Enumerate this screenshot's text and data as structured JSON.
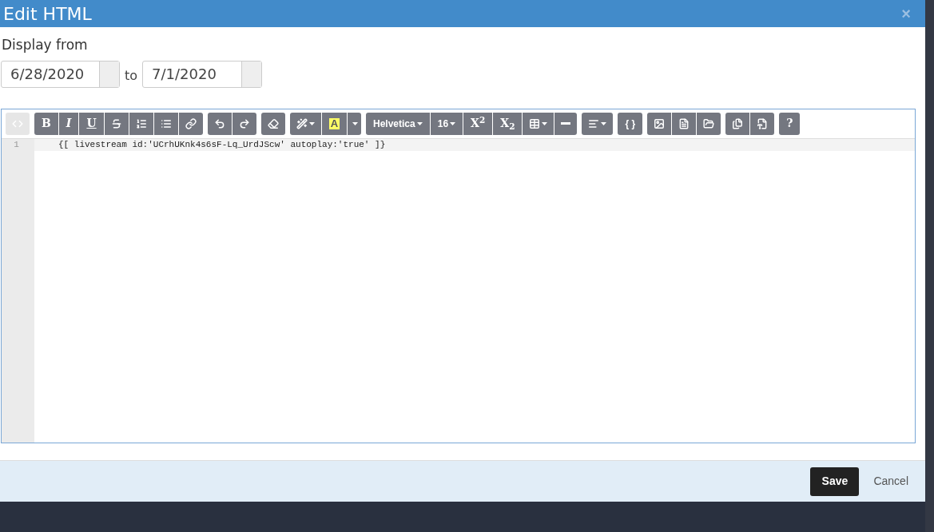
{
  "dialog": {
    "title": "Edit HTML",
    "close": "×"
  },
  "display": {
    "label": "Display from",
    "from": "6/28/2020",
    "joiner": "to",
    "to": "7/1/2020"
  },
  "toolbar": [
    [
      {
        "kind": "icon",
        "disabled": true
      }
    ],
    [
      {
        "kind": "bold",
        "label": "B"
      },
      {
        "kind": "italic",
        "label": "I"
      },
      {
        "kind": "underline",
        "label": "U"
      },
      {
        "kind": "icon"
      },
      {
        "kind": "icon"
      },
      {
        "kind": "icon"
      },
      {
        "kind": "icon"
      }
    ],
    [
      {
        "kind": "icon"
      },
      {
        "kind": "icon"
      }
    ],
    [
      {
        "kind": "icon"
      }
    ],
    [
      {
        "kind": "icon",
        "caret": true
      },
      {
        "kind": "highlight",
        "label": "A"
      },
      {
        "kind": "caret"
      }
    ],
    [
      {
        "kind": "text",
        "label": "Helvetica",
        "caret": true
      },
      {
        "kind": "text",
        "label": "16",
        "caret": true
      },
      {
        "kind": "bold",
        "label": "X$^{2}$"
      },
      {
        "kind": "bold",
        "label": "X$_{2}$"
      },
      {
        "kind": "icon",
        "caret": true
      },
      {
        "kind": "icon"
      }
    ],
    [
      {
        "kind": "icon",
        "caret": true
      }
    ],
    [
      {
        "kind": "text",
        "label": "{ }"
      }
    ],
    [
      {
        "kind": "icon"
      },
      {
        "kind": "icon"
      },
      {
        "kind": "icon"
      }
    ],
    [
      {
        "kind": "icon"
      },
      {
        "kind": "icon"
      }
    ],
    [
      {
        "kind": "bold",
        "label": "?"
      }
    ]
  ],
  "editor": {
    "lines": [
      {
        "number": "1",
        "code": "{[ livestream id:'UCrhUKnk4s6sF-Lq_UrdJScw' autoplay:'true' ]}",
        "current": true
      }
    ]
  },
  "footer": {
    "buttons": [
      {
        "label": "Save",
        "kind": "primary"
      },
      {
        "label": "Cancel",
        "kind": "link"
      }
    ]
  }
}
